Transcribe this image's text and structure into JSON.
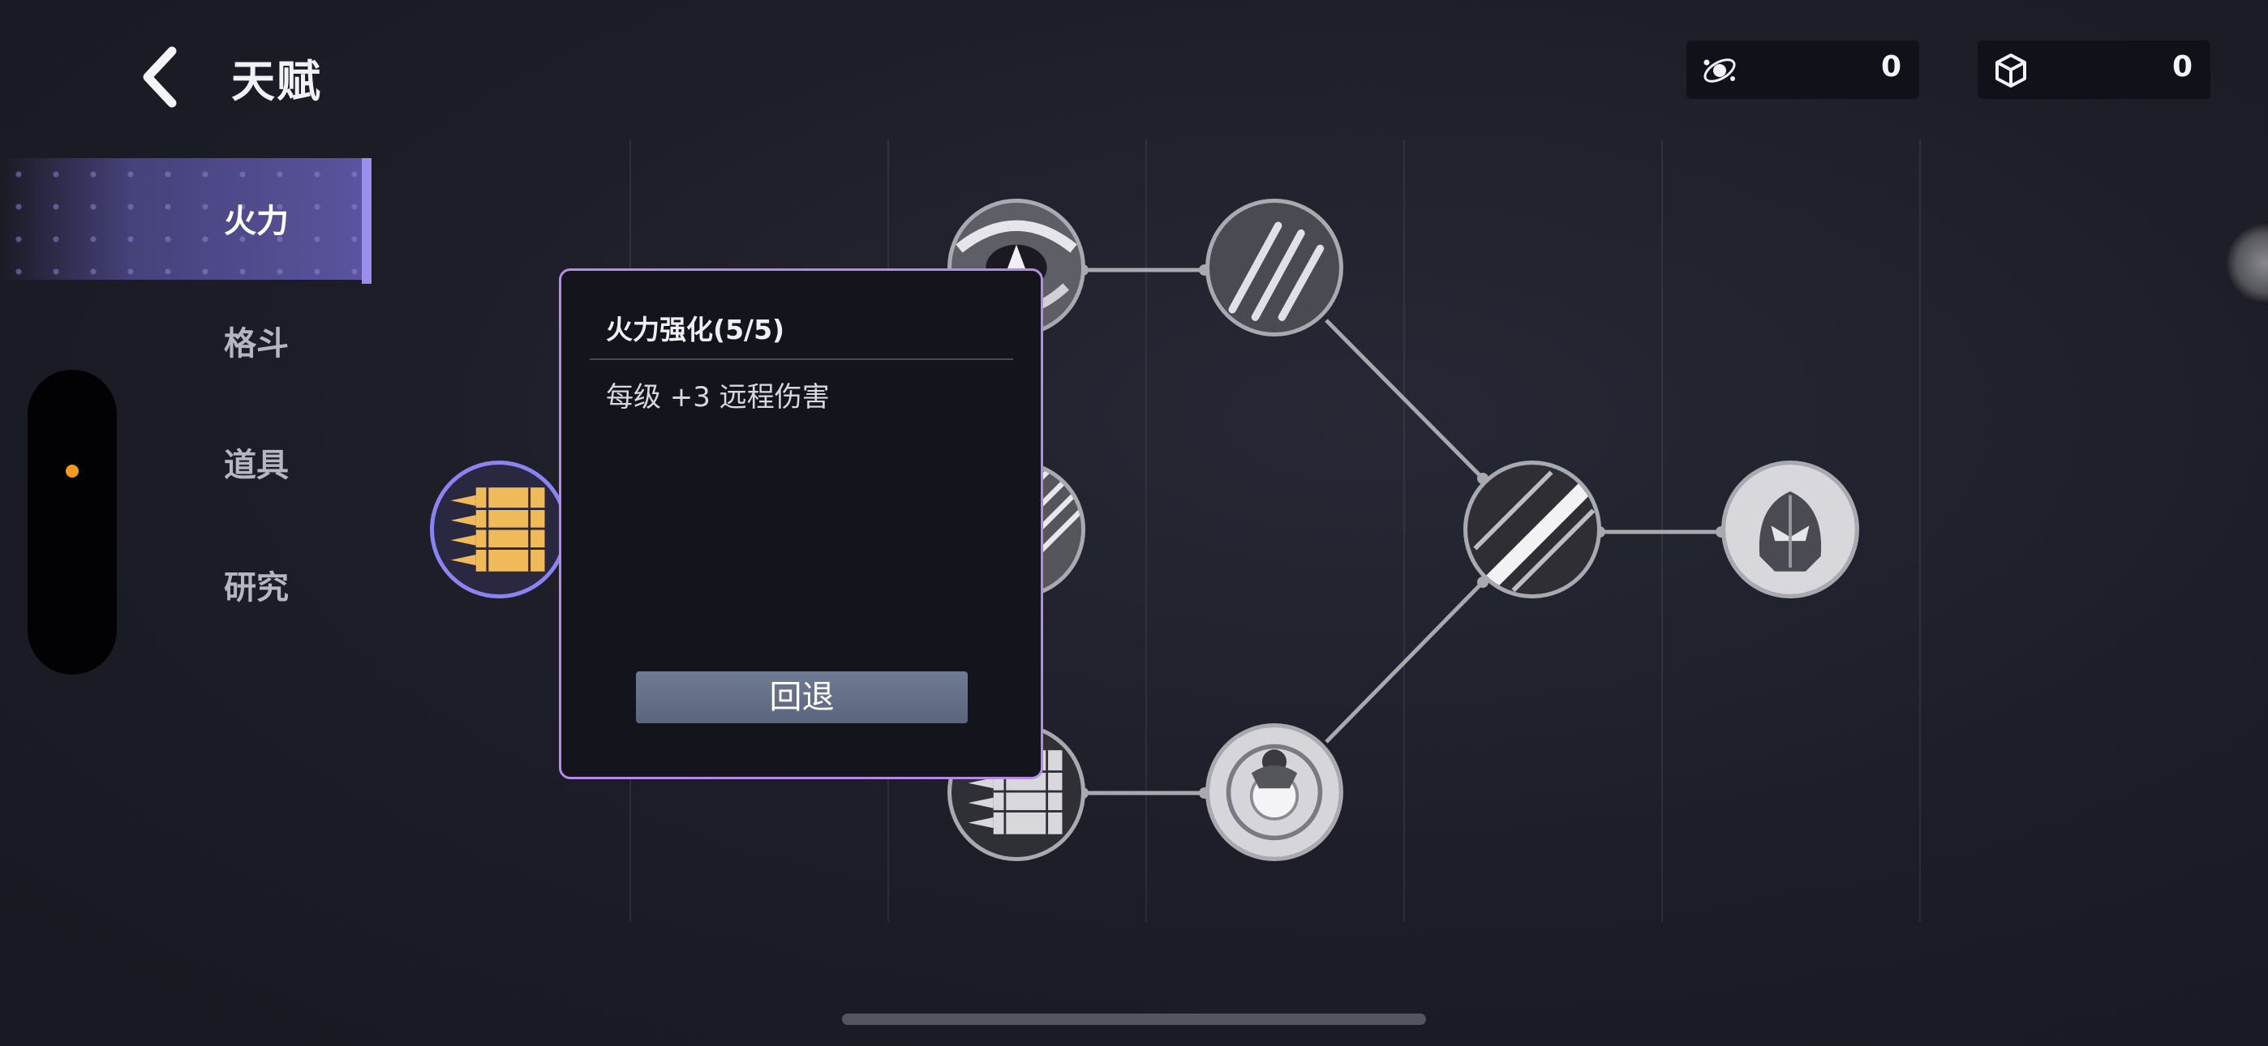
{
  "header": {
    "title": "天赋",
    "back_icon": "chevron-left-icon",
    "resources": [
      {
        "icon": "planet-orbit-icon",
        "value": "0"
      },
      {
        "icon": "cube-icon",
        "value": "0"
      }
    ]
  },
  "sidebar": {
    "items": [
      {
        "label": "火力",
        "active": true
      },
      {
        "label": "格斗",
        "active": false
      },
      {
        "label": "道具",
        "active": false
      },
      {
        "label": "研究",
        "active": false
      }
    ]
  },
  "talent_tree": {
    "nodes": [
      {
        "name": "bullets-node",
        "icon": "bullets-icon",
        "state": "selected"
      },
      {
        "name": "eye-slash-node",
        "icon": "eye-slash-icon"
      },
      {
        "name": "streaks-node",
        "icon": "streaks-icon"
      },
      {
        "name": "white-bullets-node",
        "icon": "bullets-icon"
      },
      {
        "name": "claw-slash-node",
        "icon": "claw-slash-icon"
      },
      {
        "name": "shockwave-node",
        "icon": "shockwave-icon"
      },
      {
        "name": "power-slash-node",
        "icon": "power-slash-icon"
      },
      {
        "name": "armored-helmet-node",
        "icon": "helmet-icon"
      }
    ]
  },
  "popup": {
    "title": "火力强化(5/5)",
    "description": "每级 +3 远程伤害",
    "undo_label": "回退"
  },
  "colors": {
    "accent": "#9a8fef",
    "popup_border": "#b28ce8",
    "dot": "#f39a22",
    "bullet": "#f0b95a"
  }
}
